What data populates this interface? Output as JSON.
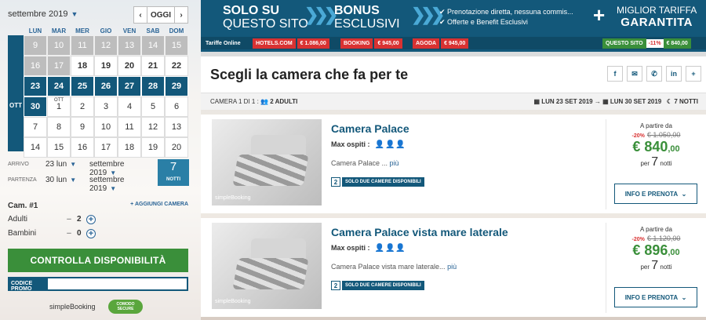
{
  "calendar": {
    "month_label": "settembre 2019",
    "today_label": "OGGI",
    "prev_icon": "chevron-left-icon",
    "next_icon": "chevron-right-icon",
    "weekdays": [
      "LUN",
      "MAR",
      "MER",
      "GIO",
      "VEN",
      "SAB",
      "DOM"
    ],
    "month_side_label": "OTT",
    "days": [
      [
        "9",
        "10",
        "11",
        "12",
        "13",
        "14",
        "15"
      ],
      [
        "16",
        "17",
        "18",
        "19",
        "20",
        "21",
        "22"
      ],
      [
        "23",
        "24",
        "25",
        "26",
        "27",
        "28",
        "29"
      ],
      [
        "30",
        "1",
        "2",
        "3",
        "4",
        "5",
        "6"
      ],
      [
        "7",
        "8",
        "9",
        "10",
        "11",
        "12",
        "13"
      ],
      [
        "14",
        "15",
        "16",
        "17",
        "18",
        "19",
        "20"
      ]
    ],
    "ott_tag": "OTT"
  },
  "booking": {
    "arrivo_label": "ARRIVO",
    "arrivo_day": "23 lun",
    "arrivo_month": "settembre 2019",
    "partenza_label": "PARTENZA",
    "partenza_day": "30 lun",
    "partenza_month": "settembre 2019",
    "nights": "7",
    "nights_label": "NOTTI",
    "room_label": "Cam. #1",
    "add_room": "+ AGGIUNGI CAMERA",
    "adults_label": "Adulti",
    "adults": "2",
    "children_label": "Bambini",
    "children": "0",
    "check_button": "CONTROLLA DISPONIBILITÀ",
    "promo_label": "CODICE PROMO",
    "promo_value": "",
    "footer_brand": "simpleBooking",
    "secure_badge": "COMODO SECURE"
  },
  "banner": {
    "l1a": "SOLO SU",
    "l1b": "QUESTO SITO",
    "l2a": "BONUS",
    "l2b": "ESCLUSIVI",
    "bullet1": "✔ Prenotazione diretta, nessuna commis...",
    "bullet2": "✔ Offerte e Benefit Esclusivi",
    "best_small": "MIGLIOR TARIFFA",
    "best_big": "GARANTITA",
    "tariffe_label": "Tariffe Online",
    "hotels_name": "HOTELS.COM",
    "hotels_price": "€ 1.086,00",
    "booking_name": "BOOKING",
    "booking_price": "€ 945,00",
    "agoda_name": "AGODA",
    "agoda_price": "€ 945,00",
    "site_label": "QUESTO SITO",
    "site_discount": "-11%",
    "site_price": "€ 840,00"
  },
  "main": {
    "title": "Scegli la camera che fa per te",
    "share_icons": [
      "f",
      "✉",
      "✆",
      "in",
      "+"
    ],
    "room_info": "CAMERA 1 DI 1 :",
    "adults_info": "2 ADULTI",
    "date_from": "LUN 23 SET 2019",
    "date_to": "LUN 30 SET 2019",
    "nights_info": "7 NOTTI"
  },
  "rooms": [
    {
      "name": "Camera Palace",
      "max_label": "Max ospiti :",
      "desc": "Camera Palace ...",
      "more": "più",
      "avail_num": "2",
      "avail_text": "SOLO DUE CAMERE DISPONIBILI",
      "from": "A partire da",
      "discount": "-20%",
      "old_price": "€ 1.050,00",
      "price_main": "€ 840",
      "price_cents": ",00",
      "per": "per",
      "nights": "7",
      "nights_label": "notti",
      "button": "INFO E PRENOTA"
    },
    {
      "name": "Camera Palace vista mare laterale",
      "max_label": "Max ospiti :",
      "desc": "Camera Palace vista mare laterale...",
      "more": "più",
      "avail_num": "2",
      "avail_text": "SOLO DUE CAMERE DISPONIBILI",
      "from": "A partire da",
      "discount": "-20%",
      "old_price": "€ 1.120,00",
      "price_main": "€ 896",
      "price_cents": ",00",
      "per": "per",
      "nights": "7",
      "nights_label": "notti",
      "button": "INFO E PRENOTA"
    }
  ],
  "photo_watermark": "simpleBooking"
}
